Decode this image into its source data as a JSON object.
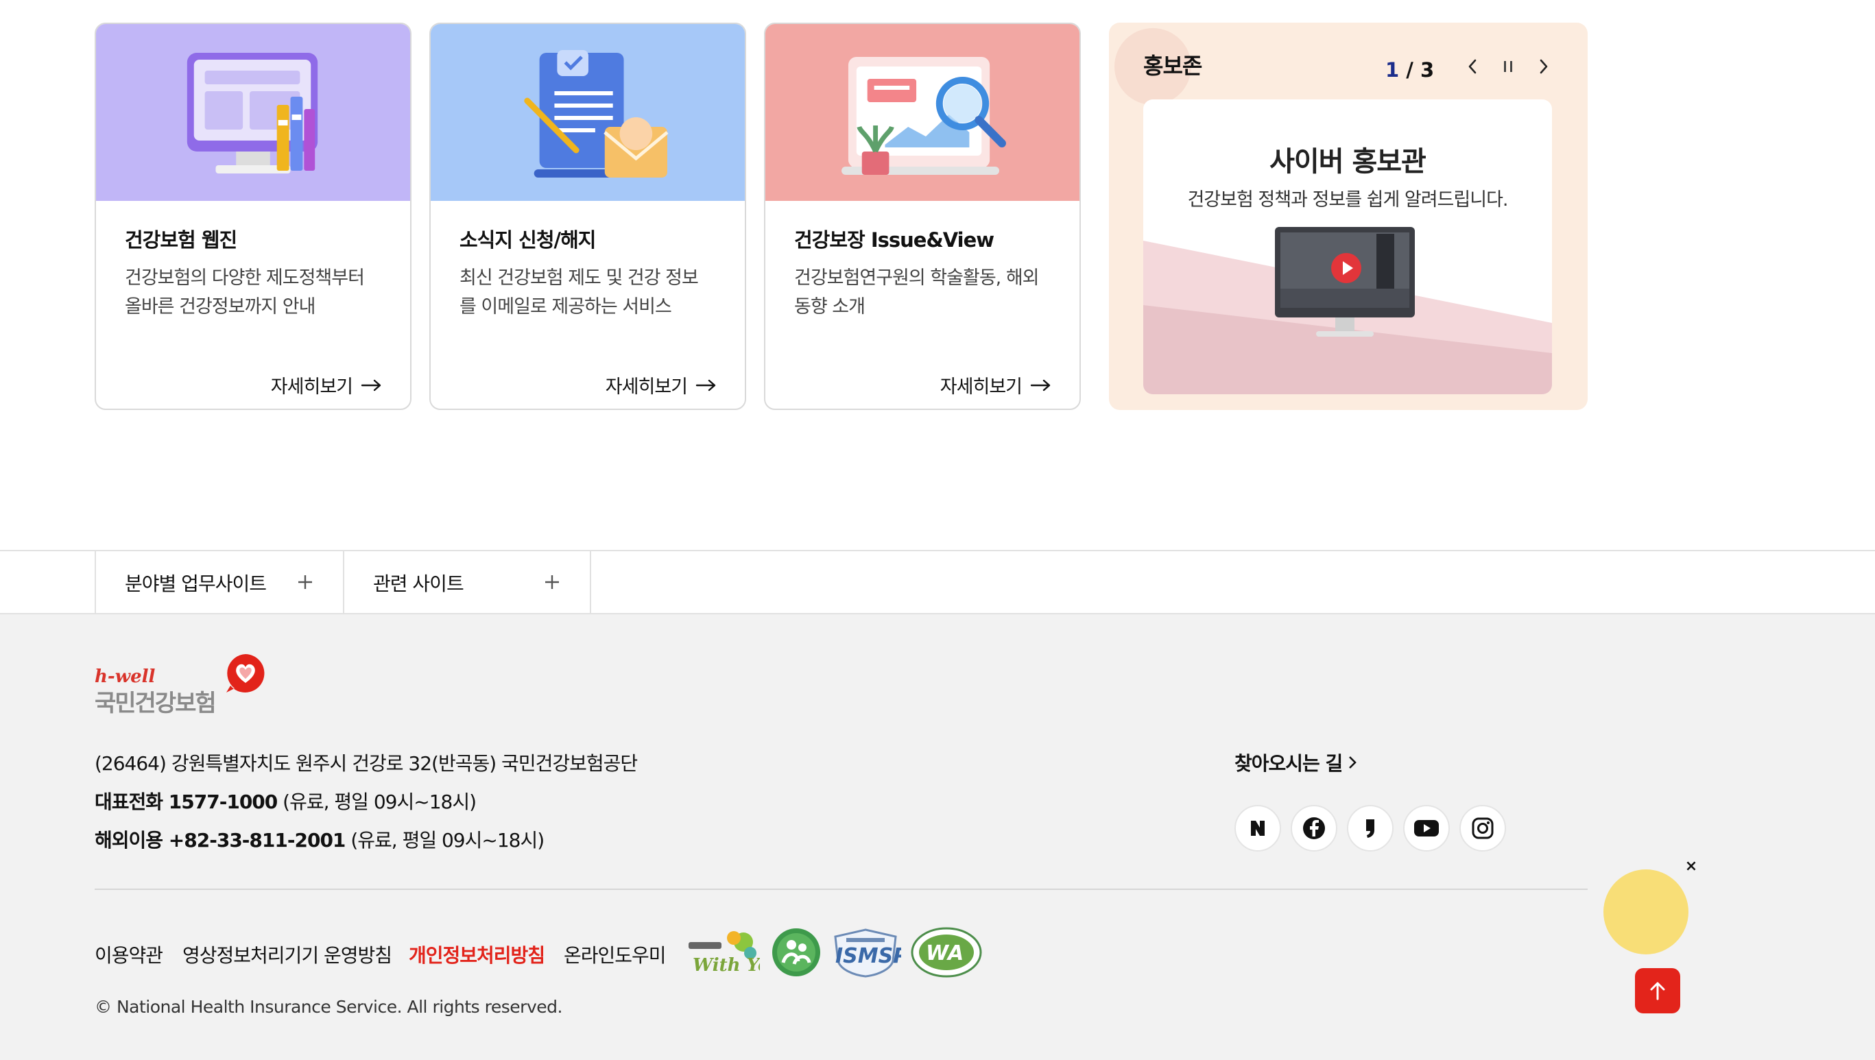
{
  "cards": [
    {
      "title": "건강보험 웹진",
      "desc_line1": "건강보험의 다양한 제도정책부터",
      "desc_line2": "올바른 건강정보까지 안내",
      "more": "자세히보기"
    },
    {
      "title": "소식지 신청/해지",
      "desc_line1": "최신 건강보험 제도 및 건강 정보",
      "desc_line2": "를 이메일로 제공하는 서비스",
      "more": "자세히보기"
    },
    {
      "title": "건강보장 Issue&View",
      "desc_line1": "건강보험연구원의 학술활동, 해외",
      "desc_line2": "동향 소개",
      "more": "자세히보기"
    }
  ],
  "promo": {
    "title": "홍보존",
    "current": "1",
    "separator": " / ",
    "total": "3",
    "slide_title": "사이버 홍보관",
    "slide_subtitle": "건강보험 정책과 정보를 쉽게 알려드립니다."
  },
  "sitebar": {
    "field_sites": "분야별 업무사이트",
    "related_sites": "관련 사이트"
  },
  "footer": {
    "logo_en": "h-well",
    "logo_kr": "국민건강보험",
    "address": "(26464) 강원특별자치도 원주시 건강로 32(반곡동) 국민건강보험공단",
    "phone_label": "대표전화 1577-1000",
    "phone_note": " (유료, 평일 09시~18시)",
    "overseas_label": "해외이용 +82-33-811-2001",
    "overseas_note": " (유료, 평일 09시~18시)",
    "directions": "찾아오시는 길",
    "links": [
      "이용약관",
      "영상정보처리기기 운영방침",
      "개인정보처리방침",
      "온라인도우미"
    ],
    "cert_withyou": "With You",
    "cert_isms": "ISMSP",
    "cert_wa": "WA",
    "copyright": "© National Health Insurance Service. All rights reserved."
  },
  "colors": {
    "card1_bg": "#c1b6f7",
    "card2_bg": "#a6c8f8",
    "card3_bg": "#f2a7a3",
    "promo_bg": "#fcecdf",
    "accent_red": "#e2231a",
    "counter_blue": "#1b2d8b",
    "chat_yellow": "#f8de77"
  },
  "icons": [
    "arrow-right-icon",
    "chevron-left-icon",
    "pause-icon",
    "chevron-right-icon",
    "plus-icon",
    "naver-blog-icon",
    "facebook-icon",
    "naver-post-icon",
    "youtube-icon",
    "instagram-icon",
    "arrow-up-icon",
    "close-icon",
    "play-icon"
  ]
}
